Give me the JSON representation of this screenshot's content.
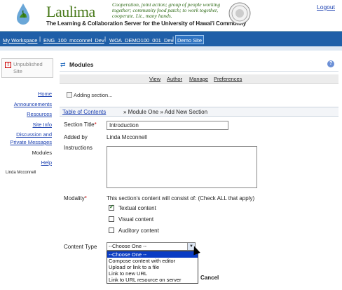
{
  "header": {
    "brand": "Laulima",
    "tagline": "Cooperation, joint action; group of people working together; community food patch; to work together, cooperate. Lit., many hands.",
    "subtitle": "The Learning & Collaboration Server for the University of Hawai'i Community",
    "logout_label": "Logout"
  },
  "site_tabs": [
    {
      "label": "My Workspace",
      "current": false
    },
    {
      "label": "ENG_100_mcconnel_Dev",
      "current": false
    },
    {
      "label": "WOA_DEMO100_001_Dev",
      "current": false
    },
    {
      "label": "Demo Site",
      "current": true
    }
  ],
  "left_nav": {
    "unpublished": "Unpublished Site",
    "tools": [
      {
        "label": "Home",
        "current": false
      },
      {
        "label": "Announcements",
        "current": false
      },
      {
        "label": "Resources",
        "current": false
      },
      {
        "label": "Site Info",
        "current": false
      },
      {
        "label": "Discussion and Private Messages",
        "current": false
      },
      {
        "label": "Modules",
        "current": true
      },
      {
        "label": "Help",
        "current": false
      }
    ],
    "user_name": "Linda Mcconnell"
  },
  "main": {
    "title": "Modules",
    "menu": [
      "View",
      "Author",
      "Manage",
      "Preferences"
    ],
    "adding_status": "Adding section...",
    "breadcrumb_link": "Table of Contents",
    "breadcrumb_rest": "» Module One » Add New Section",
    "form": {
      "section_title_label": "Section Title",
      "section_title_value": "Introduction",
      "added_by_label": "Added by",
      "added_by_value": "Linda Mcconnell",
      "instructions_label": "Instructions",
      "modality_label": "Modality",
      "modality_hint": "This section's content will consist of: (Check ALL that apply)",
      "modalities": [
        {
          "label": "Textual content",
          "checked": true
        },
        {
          "label": "Visual content",
          "checked": false
        },
        {
          "label": "Auditory content",
          "checked": false
        }
      ],
      "content_type_label": "Content Type",
      "content_type_selected": "--Choose One --",
      "content_type_options": [
        "--Choose One --",
        "Compose content with editor",
        "Upload or link to a file",
        "Link to new URL",
        "Link to URL resource on server"
      ],
      "cancel_label": "Cancel"
    }
  },
  "colors": {
    "site_bar": "#1f5fa8",
    "link": "#1a3fb0",
    "brand_green": "#4a7a1c",
    "dropdown_selected": "#0a3cc4",
    "required": "#cc0000"
  }
}
